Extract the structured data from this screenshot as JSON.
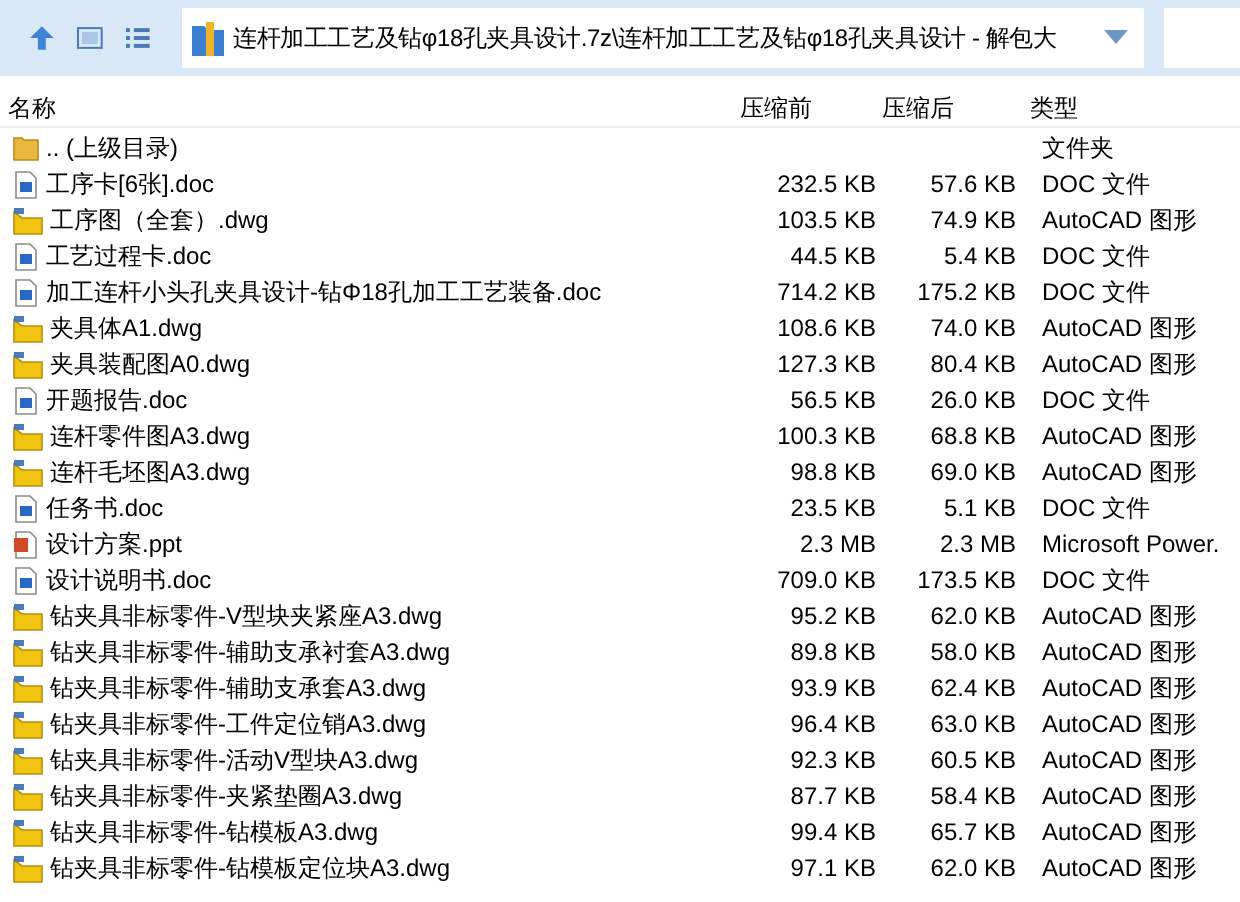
{
  "address": {
    "path": "连杆加工工艺及钻φ18孔夹具设计.7z\\连杆加工工艺及钻φ18孔夹具设计 - 解包大"
  },
  "columns": [
    {
      "label": "名称"
    },
    {
      "label": "压缩前"
    },
    {
      "label": "压缩后"
    },
    {
      "label": "类型"
    }
  ],
  "files": [
    {
      "kind": "folder",
      "name": ".. (上级目录)",
      "type": "文件夹"
    },
    {
      "kind": "doc",
      "name": "工序卡[6张].doc",
      "size": "232.5 KB",
      "packed": "57.6 KB",
      "type": "DOC 文件"
    },
    {
      "kind": "dwg",
      "name": "工序图（全套）.dwg",
      "size": "103.5 KB",
      "packed": "74.9 KB",
      "type": "AutoCAD 图形"
    },
    {
      "kind": "doc",
      "name": "工艺过程卡.doc",
      "size": "44.5 KB",
      "packed": "5.4 KB",
      "type": "DOC 文件"
    },
    {
      "kind": "doc",
      "name": "加工连杆小头孔夹具设计-钻Φ18孔加工工艺装备.doc",
      "size": "714.2 KB",
      "packed": "175.2 KB",
      "type": "DOC 文件"
    },
    {
      "kind": "dwg",
      "name": "夹具体A1.dwg",
      "size": "108.6 KB",
      "packed": "74.0 KB",
      "type": "AutoCAD 图形"
    },
    {
      "kind": "dwg",
      "name": "夹具装配图A0.dwg",
      "size": "127.3 KB",
      "packed": "80.4 KB",
      "type": "AutoCAD 图形"
    },
    {
      "kind": "doc",
      "name": "开题报告.doc",
      "size": "56.5 KB",
      "packed": "26.0 KB",
      "type": "DOC 文件"
    },
    {
      "kind": "dwg",
      "name": "连杆零件图A3.dwg",
      "size": "100.3 KB",
      "packed": "68.8 KB",
      "type": "AutoCAD 图形"
    },
    {
      "kind": "dwg",
      "name": "连杆毛坯图A3.dwg",
      "size": "98.8 KB",
      "packed": "69.0 KB",
      "type": "AutoCAD 图形"
    },
    {
      "kind": "doc",
      "name": "任务书.doc",
      "size": "23.5 KB",
      "packed": "5.1 KB",
      "type": "DOC 文件"
    },
    {
      "kind": "ppt",
      "name": "设计方案.ppt",
      "size": "2.3 MB",
      "packed": "2.3 MB",
      "type": "Microsoft Power."
    },
    {
      "kind": "doc",
      "name": "设计说明书.doc",
      "size": "709.0 KB",
      "packed": "173.5 KB",
      "type": "DOC 文件"
    },
    {
      "kind": "dwg",
      "name": "钻夹具非标零件-V型块夹紧座A3.dwg",
      "size": "95.2 KB",
      "packed": "62.0 KB",
      "type": "AutoCAD 图形"
    },
    {
      "kind": "dwg",
      "name": "钻夹具非标零件-辅助支承衬套A3.dwg",
      "size": "89.8 KB",
      "packed": "58.0 KB",
      "type": "AutoCAD 图形"
    },
    {
      "kind": "dwg",
      "name": "钻夹具非标零件-辅助支承套A3.dwg",
      "size": "93.9 KB",
      "packed": "62.4 KB",
      "type": "AutoCAD 图形"
    },
    {
      "kind": "dwg",
      "name": "钻夹具非标零件-工件定位销A3.dwg",
      "size": "96.4 KB",
      "packed": "63.0 KB",
      "type": "AutoCAD 图形"
    },
    {
      "kind": "dwg",
      "name": "钻夹具非标零件-活动V型块A3.dwg",
      "size": "92.3 KB",
      "packed": "60.5 KB",
      "type": "AutoCAD 图形"
    },
    {
      "kind": "dwg",
      "name": "钻夹具非标零件-夹紧垫圈A3.dwg",
      "size": "87.7 KB",
      "packed": "58.4 KB",
      "type": "AutoCAD 图形"
    },
    {
      "kind": "dwg",
      "name": "钻夹具非标零件-钻模板A3.dwg",
      "size": "99.4 KB",
      "packed": "65.7 KB",
      "type": "AutoCAD 图形"
    },
    {
      "kind": "dwg",
      "name": "钻夹具非标零件-钻模板定位块A3.dwg",
      "size": "97.1 KB",
      "packed": "62.0 KB",
      "type": "AutoCAD 图形"
    }
  ]
}
